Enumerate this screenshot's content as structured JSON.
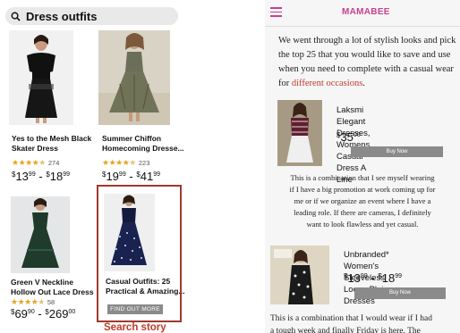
{
  "search": {
    "query": "Dress outfits"
  },
  "results": [
    {
      "title_line1": "Yes to the Mesh Black",
      "title_line2": "Skater Dress",
      "rating_count": "274",
      "price_a_whole": "13",
      "price_a_cents": "99",
      "price_b_whole": "18",
      "price_b_cents": "99",
      "currency": "$",
      "sep": "-"
    },
    {
      "title_line1": "Summer Chiffon",
      "title_line2": "Homecoming Dresse...",
      "rating_count": "223",
      "price_a_whole": "19",
      "price_a_cents": "99",
      "price_b_whole": "41",
      "price_b_cents": "99",
      "currency": "$",
      "sep": "-"
    },
    {
      "title_line1": "Green V Neckline",
      "title_line2": "Hollow Out Lace Dress",
      "rating_count": "58",
      "price_a_whole": "69",
      "price_a_cents": "90",
      "price_b_whole": "269",
      "price_b_cents": "00",
      "currency": "$",
      "sep": "-"
    },
    {
      "title_line1": "Casual Outfits: 25",
      "title_line2": "Practical & Amazing..."
    }
  ],
  "story": {
    "button_label": "FIND OUT MORE",
    "caption": "Search story"
  },
  "article": {
    "brand": "MAMABEE",
    "intro_line1": "We went through a lot of stylish looks and pick",
    "intro_line2": "the top 25 that you would like to save and use",
    "intro_line3": "when you need to complete with a casual wear",
    "intro_for": "for",
    "intro_link": "different occasions",
    "intro_end": ".",
    "products": [
      {
        "title_line1": "Laksmi Elegant Dresses,",
        "title_line2": "Womens Casual Dress A Line",
        "price_whole": "35",
        "price_cents": "00",
        "currency": "$",
        "buy_label": "Buy Now"
      },
      {
        "title_line1": "Unbranded* Women's",
        "title_line2": "Sleeveless Loose Plain Dresses",
        "price_a_whole": "13",
        "price_a_cents": "99",
        "price_b_whole": "18",
        "price_b_cents": "99",
        "currency": "$",
        "sep": "-",
        "buy_label": "Buy Now"
      }
    ],
    "para1": [
      "This is a combination that I see myself wearing",
      "if I have a big promotion at work coming up for",
      "me or if we organize an event where I have a",
      "leading role. If there are cameras, I definitely",
      "want to look flawless and yet casual."
    ],
    "para2_line1": "This is a combination that I would wear if I had",
    "para2_line2": "a tough week and finally Friday is here. The"
  },
  "colors": {
    "accent_pink": "#c9408f",
    "highlight_red": "#9e3a2e",
    "link_red": "#c0392b",
    "star": "#e8a21f"
  }
}
